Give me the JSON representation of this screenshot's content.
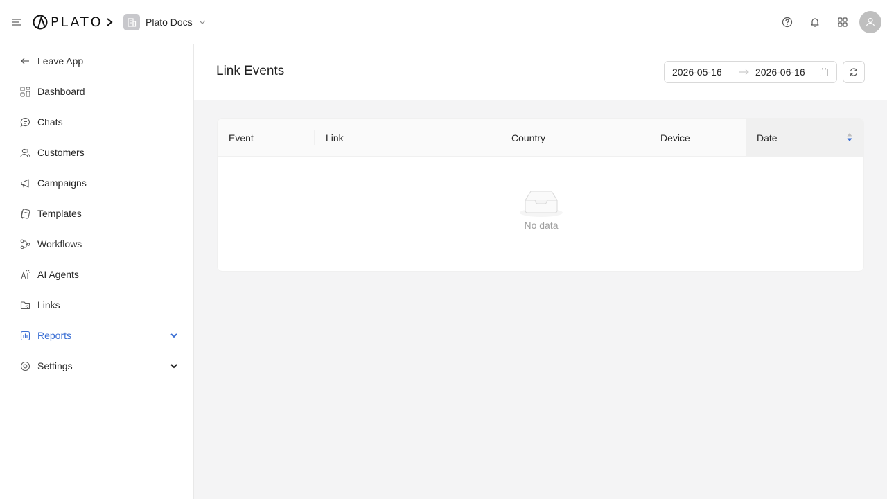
{
  "app": {
    "logo_text": "PLATO",
    "workspace_name": "Plato Docs"
  },
  "sidebar": {
    "items": [
      {
        "label": "Leave App",
        "icon": "arrow-left-icon"
      },
      {
        "label": "Dashboard",
        "icon": "dashboard-icon"
      },
      {
        "label": "Chats",
        "icon": "chat-icon"
      },
      {
        "label": "Customers",
        "icon": "users-icon"
      },
      {
        "label": "Campaigns",
        "icon": "megaphone-icon"
      },
      {
        "label": "Templates",
        "icon": "templates-icon"
      },
      {
        "label": "Workflows",
        "icon": "workflow-icon"
      },
      {
        "label": "AI Agents",
        "icon": "ai-agent-icon"
      },
      {
        "label": "Links",
        "icon": "link-folder-icon"
      },
      {
        "label": "Reports",
        "icon": "reports-icon"
      },
      {
        "label": "Settings",
        "icon": "settings-icon"
      }
    ],
    "active_label": "Reports",
    "active_color": "#3b6fd4"
  },
  "page": {
    "title": "Link Events",
    "date_start": "2026-05-16",
    "date_end": "2026-06-16"
  },
  "table": {
    "columns": [
      "Event",
      "Link",
      "Country",
      "Device",
      "Date"
    ],
    "sorted_column": "Date",
    "rows": [],
    "empty_text": "No data"
  }
}
